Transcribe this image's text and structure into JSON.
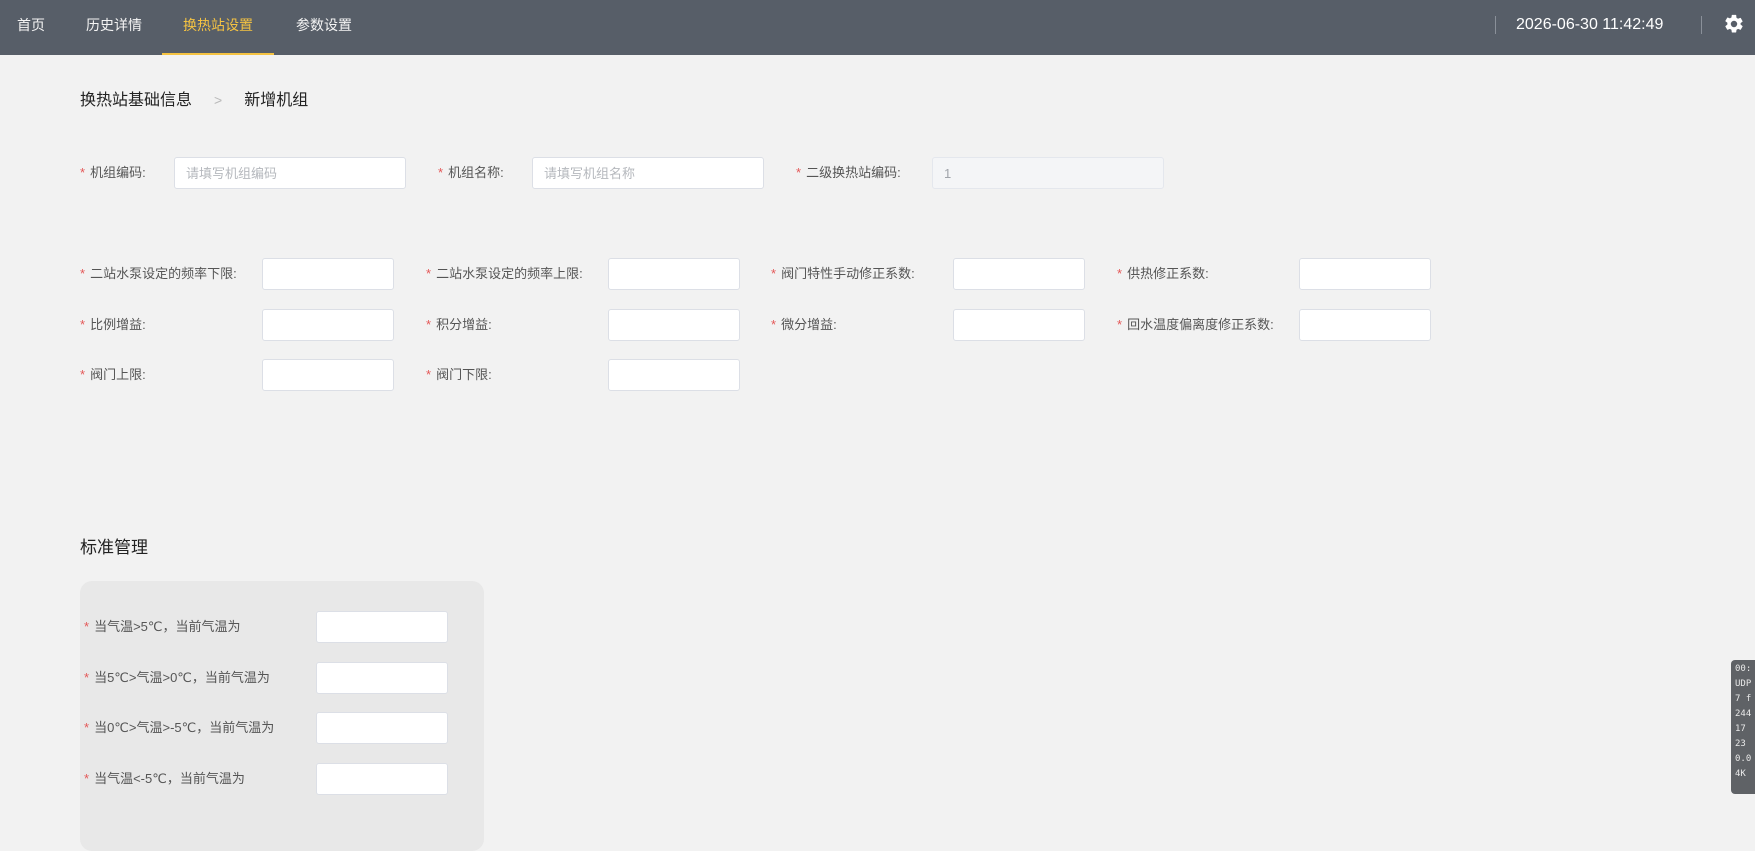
{
  "nav": {
    "items": [
      {
        "label": "首页"
      },
      {
        "label": "历史详情"
      },
      {
        "label": "换热站设置"
      },
      {
        "label": "参数设置"
      }
    ],
    "active_index": 2,
    "datetime": "2026-06-30 11:42:49",
    "settings_icon": "gear-icon"
  },
  "breadcrumb": {
    "items": [
      "换热站基础信息",
      "新增机组"
    ],
    "separator": ">"
  },
  "basic_info": {
    "fields": [
      {
        "label": "机组编码:",
        "required": true,
        "placeholder": "请填写机组编码",
        "value": ""
      },
      {
        "label": "机组名称:",
        "required": true,
        "placeholder": "请填写机组名称",
        "value": ""
      },
      {
        "label": "二级换热站编码:",
        "required": true,
        "placeholder": "",
        "value": "1",
        "disabled": true
      }
    ]
  },
  "params": {
    "fields": [
      {
        "label": "二站水泵设定的频率下限:",
        "required": true,
        "value": ""
      },
      {
        "label": "二站水泵设定的频率上限:",
        "required": true,
        "value": ""
      },
      {
        "label": "阀门特性手动修正系数:",
        "required": true,
        "value": ""
      },
      {
        "label": "供热修正系数:",
        "required": true,
        "value": ""
      },
      {
        "label": "比例增益:",
        "required": true,
        "value": ""
      },
      {
        "label": "积分增益:",
        "required": true,
        "value": ""
      },
      {
        "label": "微分增益:",
        "required": true,
        "value": ""
      },
      {
        "label": "回水温度偏离度修正系数:",
        "required": true,
        "value": ""
      },
      {
        "label": "阀门上限:",
        "required": true,
        "value": ""
      },
      {
        "label": "阀门下限:",
        "required": true,
        "value": ""
      }
    ]
  },
  "standard": {
    "title": "标准管理",
    "fields": [
      {
        "label": "当气温>5℃，当前气温为",
        "required": true,
        "value": ""
      },
      {
        "label": "当5℃>气温>0℃，当前气温为",
        "required": true,
        "value": ""
      },
      {
        "label": "当0℃>气温>-5℃，当前气温为",
        "required": true,
        "value": ""
      },
      {
        "label": "当气温<-5℃，当前气温为",
        "required": true,
        "value": ""
      }
    ]
  },
  "debug_overlay": {
    "lines": [
      "00:",
      "UDP",
      "7 f",
      "244",
      "17",
      "23",
      "0.0",
      "4K"
    ]
  },
  "colors": {
    "topbar": "#575e68",
    "accent": "#f5c342",
    "required": "#e45757",
    "background": "#f2f2f2"
  }
}
